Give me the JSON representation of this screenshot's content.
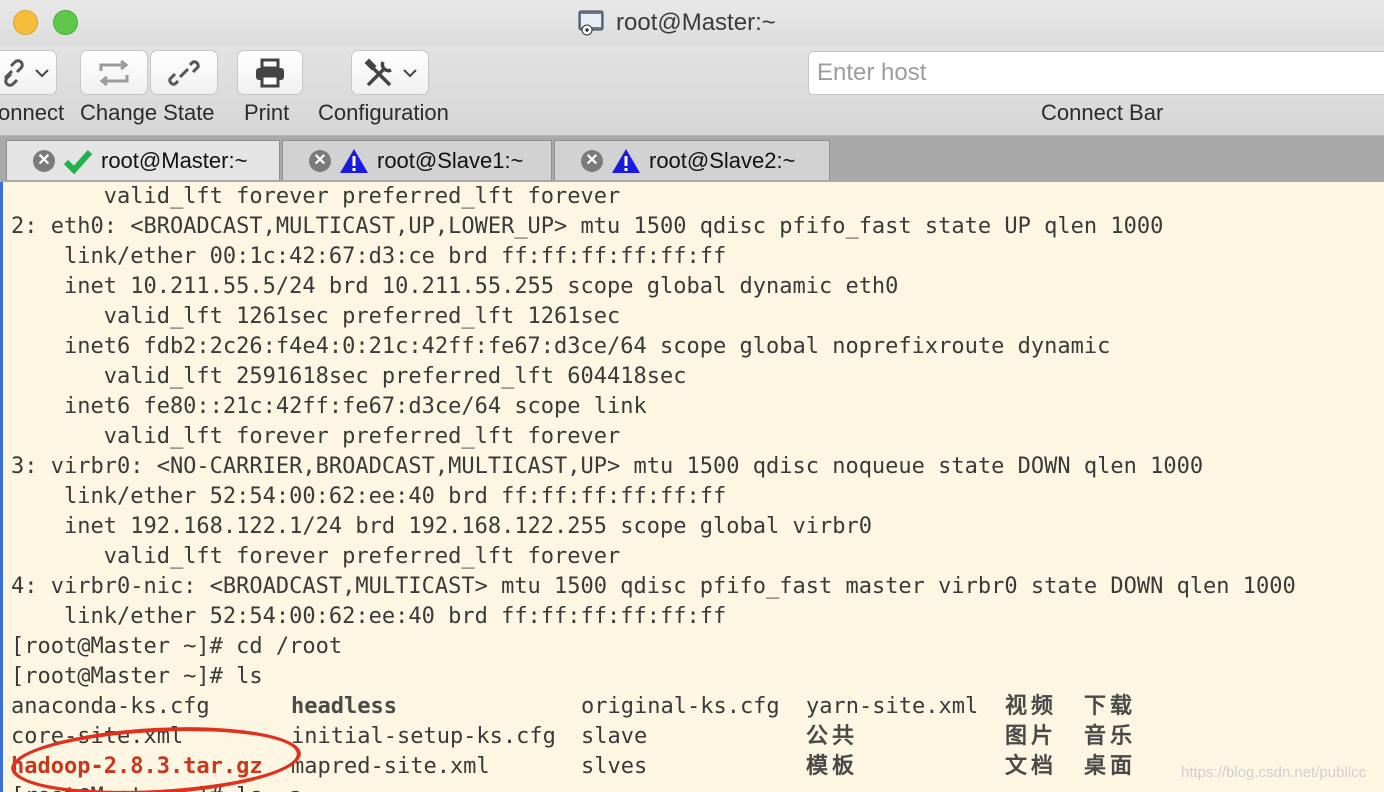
{
  "window": {
    "title": "root@Master:~"
  },
  "toolbar": {
    "connect_label": "onnect",
    "change_state_label": "Change State",
    "print_label": "Print",
    "configuration_label": "Configuration",
    "host_placeholder": "Enter host",
    "connect_bar_label": "Connect Bar"
  },
  "tabs": [
    {
      "label": "root@Master:~",
      "status": "ok",
      "active": true
    },
    {
      "label": "root@Slave1:~",
      "status": "warning",
      "active": false
    },
    {
      "label": "root@Slave2:~",
      "status": "warning",
      "active": false
    }
  ],
  "colors": {
    "terminal_bg": "#fdf6e3",
    "ok_check": "#22b14c",
    "warning": "#1b1bdc",
    "annotation": "#e0301e"
  },
  "terminal": {
    "lines": [
      "       valid_lft forever preferred_lft forever",
      "2: eth0: <BROADCAST,MULTICAST,UP,LOWER_UP> mtu 1500 qdisc pfifo_fast state UP qlen 1000",
      "    link/ether 00:1c:42:67:d3:ce brd ff:ff:ff:ff:ff:ff",
      "    inet 10.211.55.5/24 brd 10.211.55.255 scope global dynamic eth0",
      "       valid_lft 1261sec preferred_lft 1261sec",
      "    inet6 fdb2:2c26:f4e4:0:21c:42ff:fe67:d3ce/64 scope global noprefixroute dynamic",
      "       valid_lft 2591618sec preferred_lft 604418sec",
      "    inet6 fe80::21c:42ff:fe67:d3ce/64 scope link",
      "       valid_lft forever preferred_lft forever",
      "3: virbr0: <NO-CARRIER,BROADCAST,MULTICAST,UP> mtu 1500 qdisc noqueue state DOWN qlen 1000",
      "    link/ether 52:54:00:62:ee:40 brd ff:ff:ff:ff:ff:ff",
      "    inet 192.168.122.1/24 brd 192.168.122.255 scope global virbr0",
      "       valid_lft forever preferred_lft forever",
      "4: virbr0-nic: <BROADCAST,MULTICAST> mtu 1500 qdisc pfifo_fast master virbr0 state DOWN qlen 1000",
      "    link/ether 52:54:00:62:ee:40 brd ff:ff:ff:ff:ff:ff",
      "[root@Master ~]# cd /root",
      "[root@Master ~]# ls"
    ],
    "ls_rows": [
      [
        "anaconda-ks.cfg",
        "headless",
        "original-ks.cfg",
        "yarn-site.xml",
        "视频",
        "下载"
      ],
      [
        "core-site.xml",
        "initial-setup-ks.cfg",
        "slave",
        "公共",
        "图片",
        "音乐"
      ],
      [
        "hadoop-2.8.3.tar.gz",
        "mapred-site.xml",
        "slves",
        "模板",
        "文档",
        "桌面"
      ]
    ],
    "last_line": "[root@Master ~]# ls -a"
  },
  "watermark": "https://blog.csdn.net/publicc"
}
